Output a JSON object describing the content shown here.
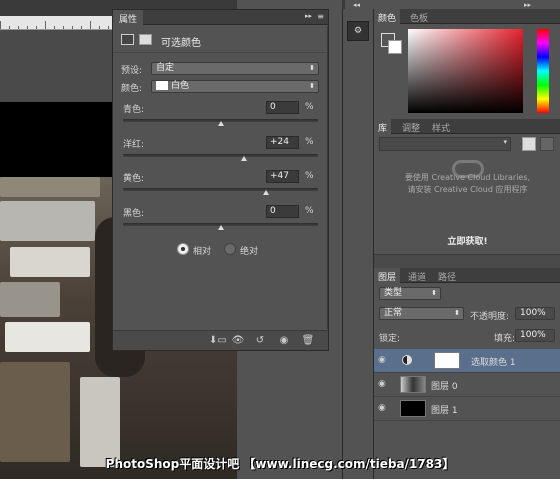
{
  "properties": {
    "tab": "属性",
    "title": "可选颜色",
    "preset_label": "预设:",
    "preset_value": "自定",
    "color_label": "颜色:",
    "color_value": "白色",
    "sliders": [
      {
        "name": "青色:",
        "value": "0",
        "unit": "%",
        "level": 0
      },
      {
        "name": "洋红:",
        "value": "+24",
        "unit": "%",
        "level": 24
      },
      {
        "name": "黄色:",
        "value": "+47",
        "unit": "%",
        "level": 47
      },
      {
        "name": "黑色:",
        "value": "0",
        "unit": "%",
        "level": 0
      }
    ],
    "mode_relative": "相对",
    "mode_absolute": "绝对",
    "mode_selected": "relative"
  },
  "color_panel": {
    "tabs": [
      "颜色",
      "色板"
    ]
  },
  "library_panel": {
    "tabs": [
      "库",
      "调整",
      "样式"
    ],
    "message_line1": "要使用 Creative Cloud Libraries,",
    "message_line2": "请安装 Creative Cloud 应用程序",
    "cta": "立即获取!"
  },
  "layers_panel": {
    "tabs": [
      "图层",
      "通道",
      "路径"
    ],
    "filter_label": "类型",
    "blend_mode": "正常",
    "opacity_label": "不透明度:",
    "opacity_value": "100%",
    "lock_label": "锁定:",
    "fill_label": "填充:",
    "fill_value": "100%",
    "layers": [
      {
        "name": "选取颜色 1"
      },
      {
        "name": "图层 0"
      },
      {
        "name": "图层 1"
      }
    ]
  },
  "watermark": "PhotoShop平面设计吧 【www.linecg.com/tieba/1783】",
  "colors": {
    "panel": "#535353",
    "dark": "#3e3e3e",
    "selected_layer": "#596f8c"
  }
}
